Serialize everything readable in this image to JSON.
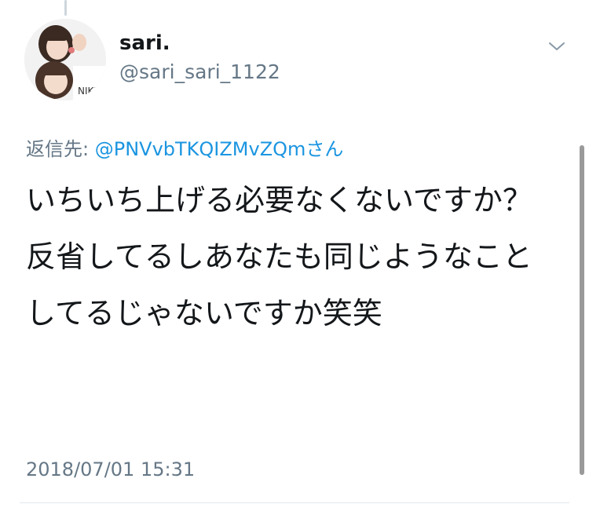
{
  "tweet": {
    "display_name": "sari.",
    "handle": "@sari_sari_1122",
    "reply_prefix": "返信先: ",
    "reply_mention": "@PNVvbTKQIZMvZQmさん",
    "paragraphs": [
      "いちいち上げる必要なくないですか？",
      "反省してるしあなたも同じようなこと",
      "してるじゃないですか笑笑"
    ],
    "timestamp": "2018/07/01 15:31"
  },
  "icons": {
    "caret": "chevron-down-icon",
    "avatar": "profile-photo"
  },
  "colors": {
    "text": "#14171a",
    "secondary": "#657786",
    "link": "#1b95e0",
    "divider": "#e1e8ed"
  }
}
